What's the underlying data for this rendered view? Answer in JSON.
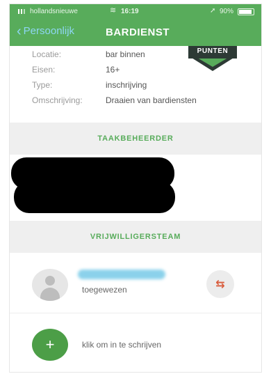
{
  "status_bar": {
    "carrier": "hollandsnieuwe",
    "wifi": "wifi-icon",
    "time": "16:19",
    "battery_text": "90%",
    "battery_icon": "battery-icon"
  },
  "nav": {
    "back_label": "Persoonlijk",
    "title": "BARDIENST"
  },
  "badge": {
    "label": "PUNTEN"
  },
  "details": [
    {
      "label": "Locatie:",
      "value": "bar binnen"
    },
    {
      "label": "Eisen:",
      "value": "16+"
    },
    {
      "label": "Type:",
      "value": "inschrijving"
    },
    {
      "label": "Omschrijving:",
      "value": "Draaien van bardiensten"
    }
  ],
  "sections": {
    "task_manager": "TAAKBEHEERDER",
    "volunteer_team": "VRIJWILLIGERSTEAM"
  },
  "volunteer": {
    "status": "toegewezen",
    "swap_icon": "swap-icon"
  },
  "signup": {
    "label": "klik om in te schrijven",
    "icon": "plus-icon"
  },
  "colors": {
    "brand_green": "#58ac5b",
    "add_button": "#4c9e47",
    "swap_orange": "#d95b3b"
  }
}
